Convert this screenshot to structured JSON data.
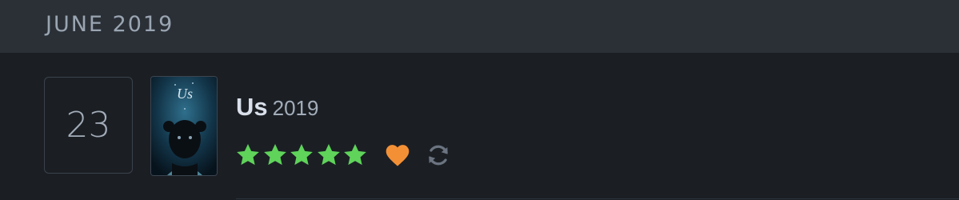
{
  "month_header": {
    "label": "JUNE 2019"
  },
  "entry": {
    "day": "23",
    "title": "Us",
    "year": "2019",
    "poster": {
      "title_text": "Us",
      "icon": "film-poster"
    },
    "rating": {
      "stars": 5,
      "max": 5,
      "color": "#5fd35a"
    },
    "liked": true,
    "like_color": "#f39036",
    "rewatch_icon": "rewatch-icon",
    "rewatch_color": "#6b7480"
  }
}
